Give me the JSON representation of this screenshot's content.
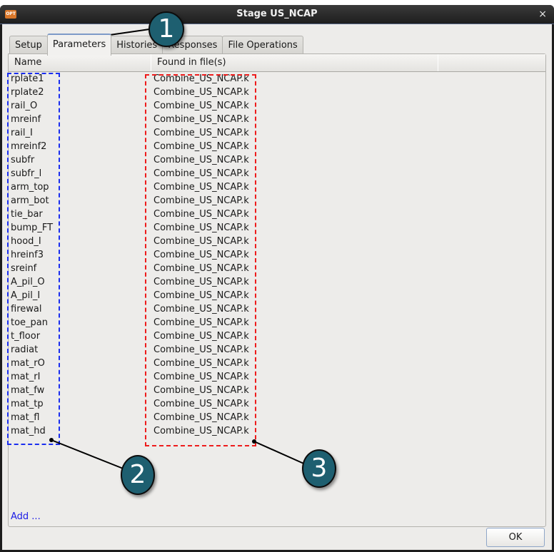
{
  "window": {
    "title": "Stage US_NCAP",
    "app_icon_label": "OPT",
    "close_glyph": "×"
  },
  "tabs": [
    {
      "label": "Setup",
      "active": false
    },
    {
      "label": "Parameters",
      "active": true
    },
    {
      "label": "Histories",
      "active": false
    },
    {
      "label": "Responses",
      "active": false
    },
    {
      "label": "File Operations",
      "active": false
    }
  ],
  "table": {
    "columns": [
      "Name",
      "Found in file(s)",
      ""
    ],
    "rows": [
      {
        "name": "rplate1",
        "file": "Combine_US_NCAP.k"
      },
      {
        "name": "rplate2",
        "file": "Combine_US_NCAP.k"
      },
      {
        "name": "rail_O",
        "file": "Combine_US_NCAP.k"
      },
      {
        "name": "mreinf",
        "file": "Combine_US_NCAP.k"
      },
      {
        "name": "rail_I",
        "file": "Combine_US_NCAP.k"
      },
      {
        "name": "mreinf2",
        "file": "Combine_US_NCAP.k"
      },
      {
        "name": "subfr",
        "file": "Combine_US_NCAP.k"
      },
      {
        "name": "subfr_l",
        "file": "Combine_US_NCAP.k"
      },
      {
        "name": "arm_top",
        "file": "Combine_US_NCAP.k"
      },
      {
        "name": "arm_bot",
        "file": "Combine_US_NCAP.k"
      },
      {
        "name": "tie_bar",
        "file": "Combine_US_NCAP.k"
      },
      {
        "name": "bump_FT",
        "file": "Combine_US_NCAP.k"
      },
      {
        "name": "hood_I",
        "file": "Combine_US_NCAP.k"
      },
      {
        "name": "hreinf3",
        "file": "Combine_US_NCAP.k"
      },
      {
        "name": "sreinf",
        "file": "Combine_US_NCAP.k"
      },
      {
        "name": "A_pil_O",
        "file": "Combine_US_NCAP.k"
      },
      {
        "name": "A_pil_I",
        "file": "Combine_US_NCAP.k"
      },
      {
        "name": "firewal",
        "file": "Combine_US_NCAP.k"
      },
      {
        "name": "toe_pan",
        "file": "Combine_US_NCAP.k"
      },
      {
        "name": "t_floor",
        "file": "Combine_US_NCAP.k"
      },
      {
        "name": "radiat",
        "file": "Combine_US_NCAP.k"
      },
      {
        "name": "mat_rO",
        "file": "Combine_US_NCAP.k"
      },
      {
        "name": "mat_rI",
        "file": "Combine_US_NCAP.k"
      },
      {
        "name": "mat_fw",
        "file": "Combine_US_NCAP.k"
      },
      {
        "name": "mat_tp",
        "file": "Combine_US_NCAP.k"
      },
      {
        "name": "mat_fl",
        "file": "Combine_US_NCAP.k"
      },
      {
        "name": "mat_hd",
        "file": "Combine_US_NCAP.k"
      }
    ]
  },
  "add_link": "Add ...",
  "ok_button": "OK",
  "annotations": {
    "callouts": [
      "1",
      "2",
      "3"
    ],
    "highlight_colors": {
      "names_box": "#1a2ef0",
      "files_box": "#ee1c1c",
      "callout_fill": "#1e5f70"
    }
  }
}
